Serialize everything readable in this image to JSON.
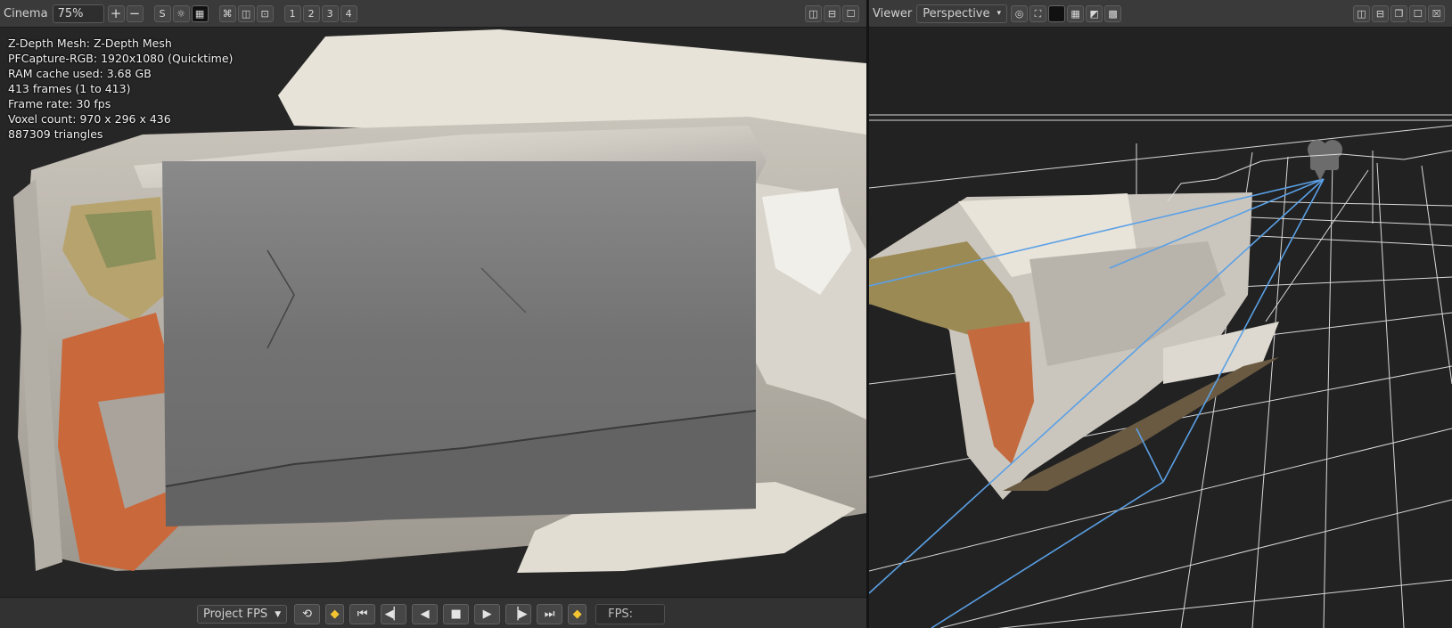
{
  "cinema": {
    "title": "Cinema",
    "zoom": "75%",
    "zoom_in_label": "+",
    "zoom_out_label": "−",
    "mode_s_label": "S",
    "channel_buttons": [
      "1",
      "2",
      "3",
      "4"
    ],
    "info_lines": [
      "Z-Depth Mesh: Z-Depth Mesh",
      "PFCapture-RGB: 1920x1080 (Quicktime)",
      "RAM cache used: 3.68 GB",
      "413 frames (1 to 413)",
      "Frame rate: 30 fps",
      "Voxel count: 970 x 296 x 436",
      "887309 triangles"
    ]
  },
  "transport": {
    "fps_select": "Project FPS",
    "fps_label": "FPS:"
  },
  "viewer": {
    "title": "Viewer",
    "projection": "Perspective"
  },
  "colors": {
    "camera_lines": "#5aa0e6",
    "grid": "#dcdcdc",
    "depth_gray": "#7a7a7a"
  }
}
